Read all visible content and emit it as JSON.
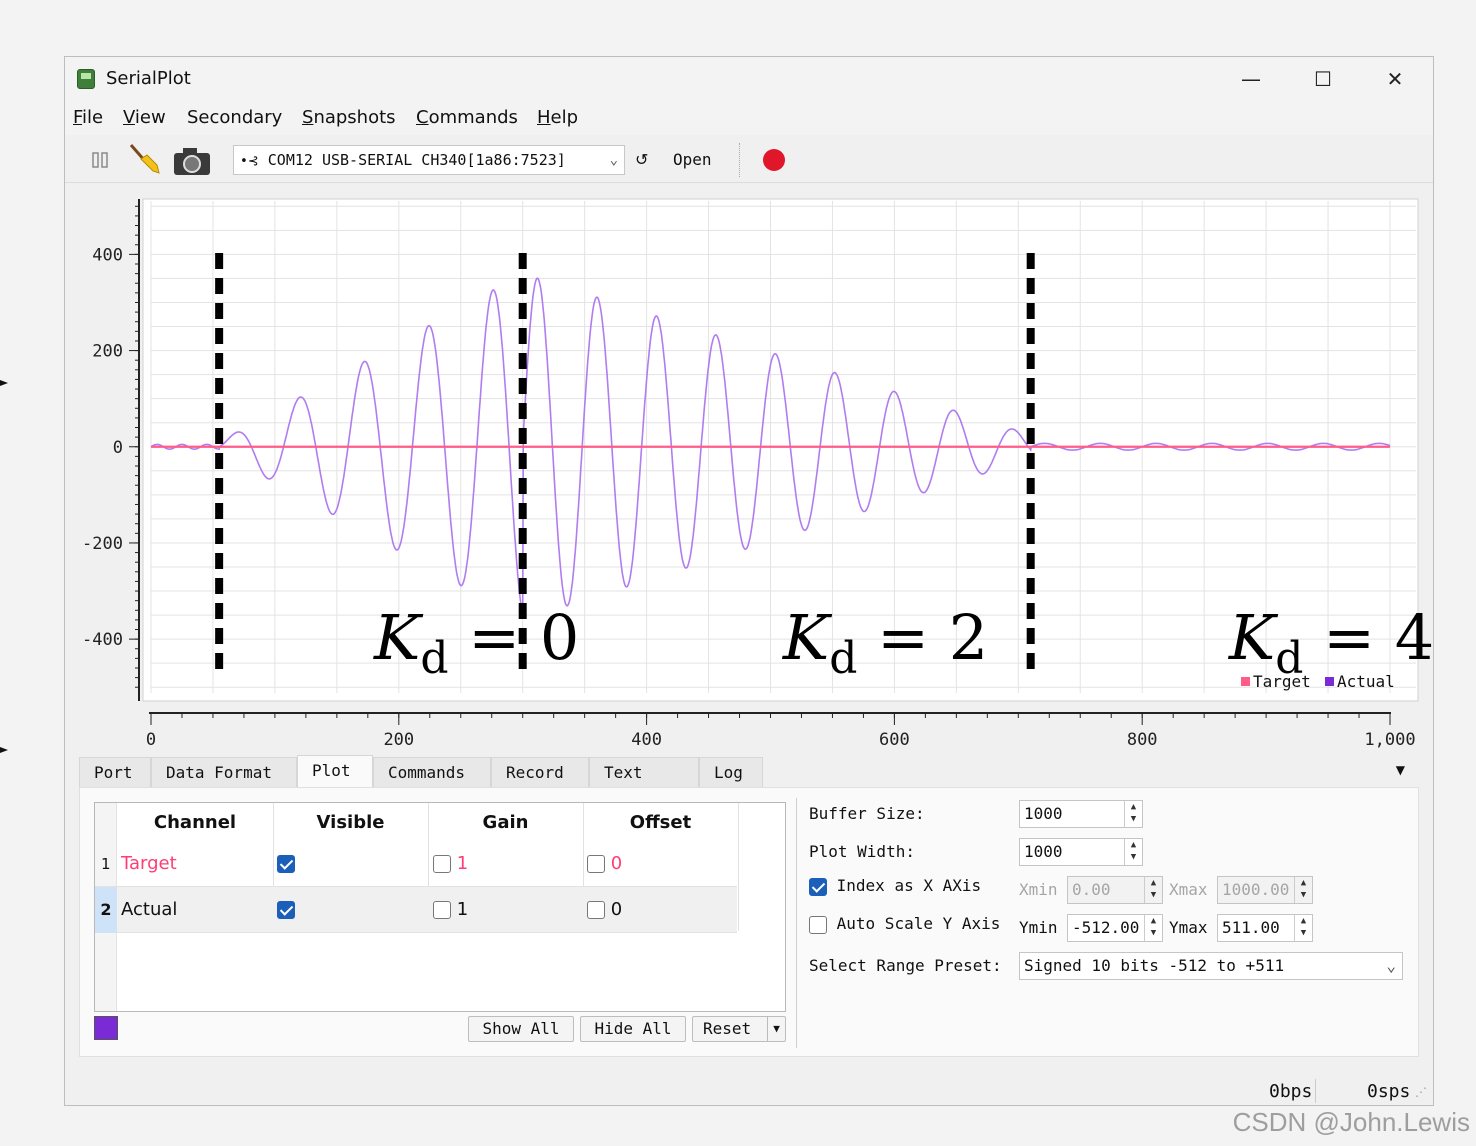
{
  "window": {
    "title": "SerialPlot",
    "controls": {
      "minimize": "—",
      "maximize": "☐",
      "close": "✕"
    }
  },
  "menu": {
    "items": [
      {
        "label": "File",
        "mnemonic": "F",
        "rest": "ile"
      },
      {
        "label": "View",
        "mnemonic": "V",
        "rest": "iew"
      },
      {
        "label": "Secondary",
        "mnemonic": "",
        "rest": "Secondary"
      },
      {
        "label": "Snapshots",
        "mnemonic": "S",
        "rest": "napshots"
      },
      {
        "label": "Commands",
        "mnemonic": "C",
        "rest": "ommands"
      },
      {
        "label": "Help",
        "mnemonic": "H",
        "rest": "elp"
      }
    ]
  },
  "toolbar": {
    "port": "COM12 USB-SERIAL CH340[1a86:7523]",
    "open_label": "Open",
    "icons": [
      "pause-icon",
      "clear-broom-icon",
      "camera-icon",
      "usb-icon",
      "refresh-icon",
      "record-icon"
    ],
    "record_color": "#e0162b"
  },
  "chart_data": {
    "type": "line",
    "xlim": [
      0,
      1000
    ],
    "ylim": [
      -512,
      511
    ],
    "x_ticks": [
      0,
      200,
      400,
      600,
      800,
      1000
    ],
    "x_tick_labels": [
      "0",
      "200",
      "400",
      "600",
      "800",
      "1,000"
    ],
    "y_ticks": [
      400,
      200,
      0,
      -200,
      -400
    ],
    "y_tick_labels": [
      "400",
      "200",
      "0",
      "-200",
      "-400"
    ],
    "grid": true,
    "legend_position": "bottom-right",
    "series": [
      {
        "name": "Target",
        "color": "#ff5c8a",
        "constant": 0
      },
      {
        "name": "Actual",
        "color": "#b07cf0",
        "segments": [
          {
            "x_start": 0,
            "x_end": 55,
            "amplitude": 5
          },
          {
            "x_start": 55,
            "x_end": 300,
            "amplitude_start": 10,
            "amplitude_end": 360,
            "period": 52
          },
          {
            "x_start": 300,
            "x_end": 710,
            "amplitude_start": 360,
            "amplitude_end": 25,
            "period": 48
          },
          {
            "x_start": 710,
            "x_end": 1000,
            "amplitude": 7,
            "period": 45
          }
        ]
      }
    ],
    "dividers": [
      55,
      300,
      710
    ],
    "annotations": [
      {
        "K": "K",
        "sub": "d",
        "eq": "= 0",
        "x": 180
      },
      {
        "K": "K",
        "sub": "d",
        "eq": "= 2",
        "x": 510
      },
      {
        "K": "K",
        "sub": "d",
        "eq": "= 4",
        "x": 870
      }
    ]
  },
  "tabs": [
    "Port",
    "Data Format",
    "Plot",
    "Commands",
    "Record",
    "Text View",
    "Log"
  ],
  "active_tab": "Plot",
  "channels": {
    "headers": [
      "Channel",
      "Visible",
      "Gain",
      "Offset"
    ],
    "rows": [
      {
        "index": "1",
        "name": "Target",
        "visible": true,
        "gain": "1",
        "offset": "0",
        "color": "#ff3d74"
      },
      {
        "index": "2",
        "name": "Actual",
        "visible": true,
        "gain": "1",
        "offset": "0",
        "color": "#111111"
      }
    ],
    "selected_color": "#7b2bd6",
    "buttons": {
      "show_all": "Show All",
      "hide_all": "Hide All",
      "reset": "Reset"
    }
  },
  "settings": {
    "buffer_size_label": "Buffer Size:",
    "buffer_size": "1000",
    "plot_width_label": "Plot Width:",
    "plot_width": "1000",
    "index_as_x_label": "Index as X AXis",
    "index_as_x": true,
    "xmin_label": "Xmin",
    "xmin": "0.00",
    "xmax_label": "Xmax",
    "xmax": "1000.00",
    "auto_scale_label": "Auto Scale Y Axis",
    "auto_scale": false,
    "ymin_label": "Ymin",
    "ymin": "-512.00",
    "ymax_label": "Ymax",
    "ymax": "511.00",
    "range_preset_label": "Select Range Preset:",
    "range_preset": "Signed 10 bits -512 to +511"
  },
  "status": {
    "bps": "0bps",
    "sps": "0sps"
  },
  "watermark": "CSDN @John.Lewis"
}
